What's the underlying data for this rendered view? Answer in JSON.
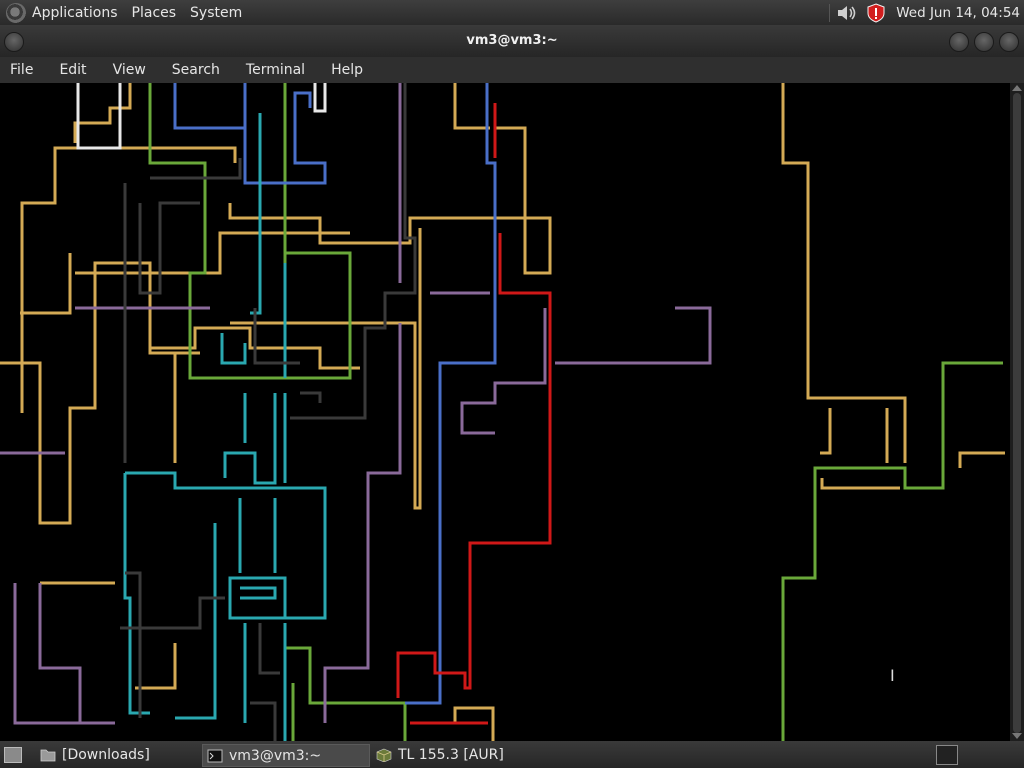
{
  "top_panel": {
    "menus": [
      "Applications",
      "Places",
      "System"
    ],
    "clock": "Wed Jun 14, 04:54",
    "icons": [
      "distro-logo-icon",
      "volume-icon",
      "shield-update-icon"
    ]
  },
  "window": {
    "title": "vm3@vm3:~",
    "menu": [
      "File",
      "Edit",
      "View",
      "Search",
      "Terminal",
      "Help"
    ]
  },
  "terminal": {
    "program": "pipes screensaver",
    "colors": {
      "yellow": "#d4aa55",
      "green": "#6aa83a",
      "blue": "#4a6fc8",
      "purple": "#8a6a9a",
      "cyan": "#2aa8b0",
      "red": "#d01818",
      "white": "#e8e8e8",
      "gray": "#3a3a3a"
    }
  },
  "taskbar": {
    "items": [
      {
        "label": "[Downloads]",
        "icon": "folder-icon",
        "active": false
      },
      {
        "label": "vm3@vm3:~",
        "icon": "terminal-icon",
        "active": true
      },
      {
        "label": "TL 155.3 [AUR]",
        "icon": "package-icon",
        "active": false
      }
    ]
  }
}
